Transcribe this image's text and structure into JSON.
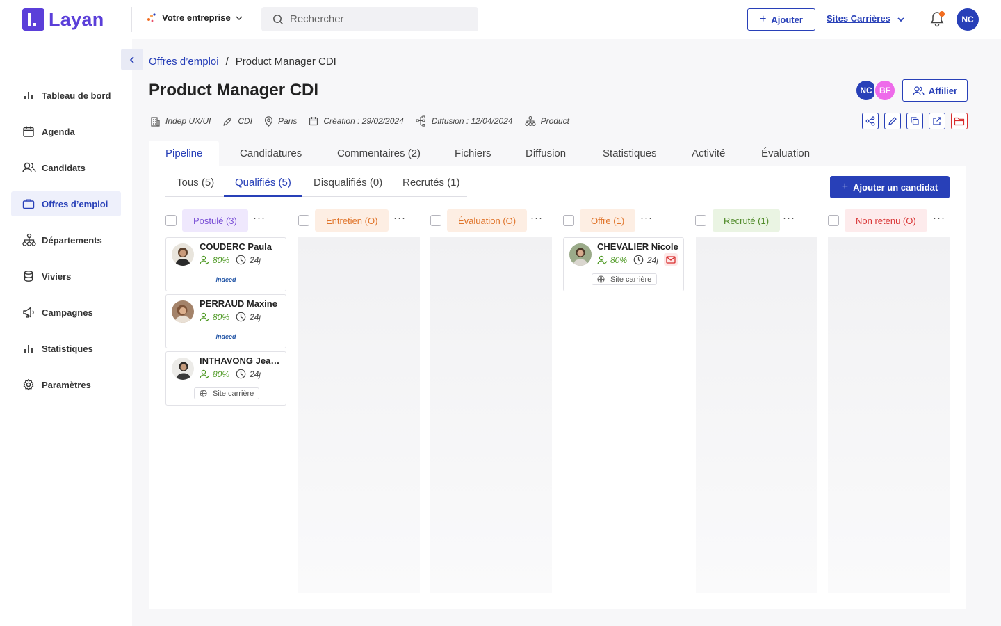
{
  "app": {
    "name": "Layan"
  },
  "topbar": {
    "company": "Votre entreprise",
    "search_placeholder": "Rechercher",
    "add_label": "Ajouter",
    "sites_label": "Sites Carrières",
    "user_initials": "NC"
  },
  "sidebar": {
    "items": [
      {
        "label": "Tableau de bord",
        "icon": "bar-chart-icon"
      },
      {
        "label": "Agenda",
        "icon": "calendar-icon"
      },
      {
        "label": "Candidats",
        "icon": "users-icon"
      },
      {
        "label": "Offres d’emploi",
        "icon": "briefcase-icon",
        "active": true
      },
      {
        "label": "Départements",
        "icon": "org-chart-icon"
      },
      {
        "label": "Viviers",
        "icon": "database-icon"
      },
      {
        "label": "Campagnes",
        "icon": "megaphone-icon"
      },
      {
        "label": "Statistiques",
        "icon": "bar-chart-icon"
      },
      {
        "label": "Paramètres",
        "icon": "gear-icon"
      }
    ]
  },
  "breadcrumb": {
    "parent": "Offres d’emploi",
    "separator": "/",
    "current": "Product Manager CDI"
  },
  "job": {
    "title": "Product Manager CDI",
    "meta": {
      "company": "Indep UX/UI",
      "contract": "CDI",
      "location": "Paris",
      "created": "Création : 29/02/2024",
      "published": "Diffusion : 12/04/2024",
      "department": "Product"
    },
    "collaborators": [
      "NC",
      "BF"
    ],
    "affiliate_label": "Affilier"
  },
  "tabs": [
    "Pipeline",
    "Candidatures",
    "Commentaires (2)",
    "Fichiers",
    "Diffusion",
    "Statistiques",
    "Activité",
    "Évaluation"
  ],
  "subtabs": [
    "Tous (5)",
    "Qualifiés (5)",
    "Disqualifiés (0)",
    "Recrutés (1)"
  ],
  "add_candidate_label": "Ajouter un candidat",
  "stages": [
    {
      "label": "Postulé (3)",
      "bg": "#efe8fd",
      "color": "#7a4fd6"
    },
    {
      "label": "Entretien (O)",
      "bg": "#fdeee3",
      "color": "#e0742a"
    },
    {
      "label": "Évaluation (O)",
      "bg": "#fdeee3",
      "color": "#e0742a"
    },
    {
      "label": "Offre (1)",
      "bg": "#fdeee3",
      "color": "#e0742a"
    },
    {
      "label": "Recruté (1)",
      "bg": "#eaf4e3",
      "color": "#4f8a28"
    },
    {
      "label": "Non retenu (O)",
      "bg": "#fdebec",
      "color": "#d93636"
    }
  ],
  "more_label": "···",
  "candidates": [
    {
      "name": "COUDERC Paula",
      "score": "80%",
      "days": "24j",
      "source": "indeed"
    },
    {
      "name": "PERRAUD Maxine",
      "score": "80%",
      "days": "24j",
      "source": "indeed"
    },
    {
      "name": "INTHAVONG Jean...",
      "score": "80%",
      "days": "24j",
      "source": "Site carrière"
    },
    {
      "name": "CHEVALIER Nicole",
      "score": "80%",
      "days": "24j",
      "source": "Site carrière"
    }
  ]
}
